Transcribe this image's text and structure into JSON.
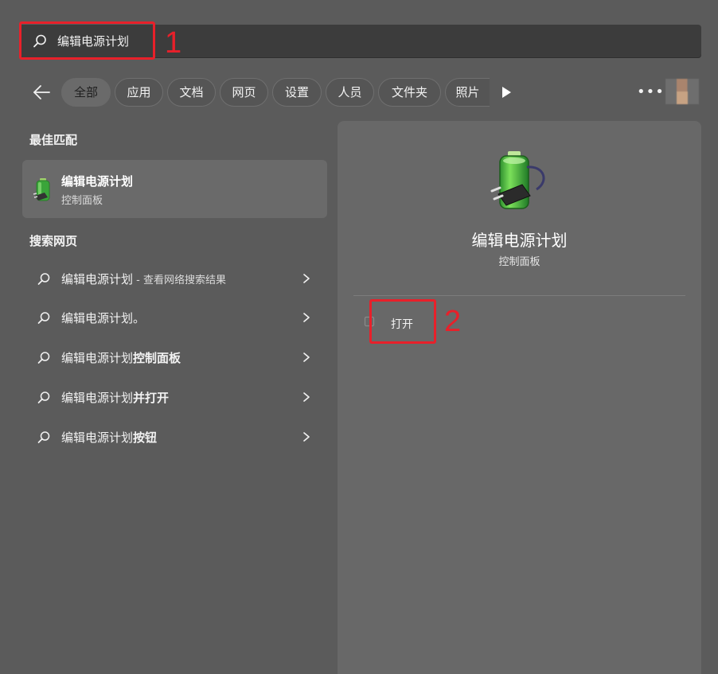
{
  "search": {
    "query": "编辑电源计划",
    "annotation_1": "1"
  },
  "filters": {
    "chips": [
      "全部",
      "应用",
      "文档",
      "网页",
      "设置",
      "人员",
      "文件夹",
      "照片"
    ]
  },
  "best_match": {
    "heading": "最佳匹配",
    "title": "编辑电源计划",
    "subtitle": "控制面板"
  },
  "web_search": {
    "heading": "搜索网页",
    "items": [
      {
        "prefix": "编辑电源计划",
        "bold": "",
        "suffix": " - 查看网络搜索结果"
      },
      {
        "prefix": "编辑电源计划。",
        "bold": "",
        "suffix": ""
      },
      {
        "prefix": "编辑电源计划",
        "bold": "控制面板",
        "suffix": ""
      },
      {
        "prefix": "编辑电源计划",
        "bold": "并打开",
        "suffix": ""
      },
      {
        "prefix": "编辑电源计划",
        "bold": "按钮",
        "suffix": ""
      }
    ]
  },
  "preview": {
    "title": "编辑电源计划",
    "subtitle": "控制面板",
    "open_label": "打开",
    "annotation_2": "2"
  },
  "icons": {
    "search": "search-icon",
    "back": "back-arrow-icon",
    "play": "play-icon",
    "more": "more-icon",
    "chevron": "chevron-right-icon",
    "power_plan": "power-plan-icon",
    "open": "open-icon"
  },
  "colors": {
    "annotation_red": "#e8202a",
    "background": "#5b5b5b",
    "panel": "#686868"
  }
}
